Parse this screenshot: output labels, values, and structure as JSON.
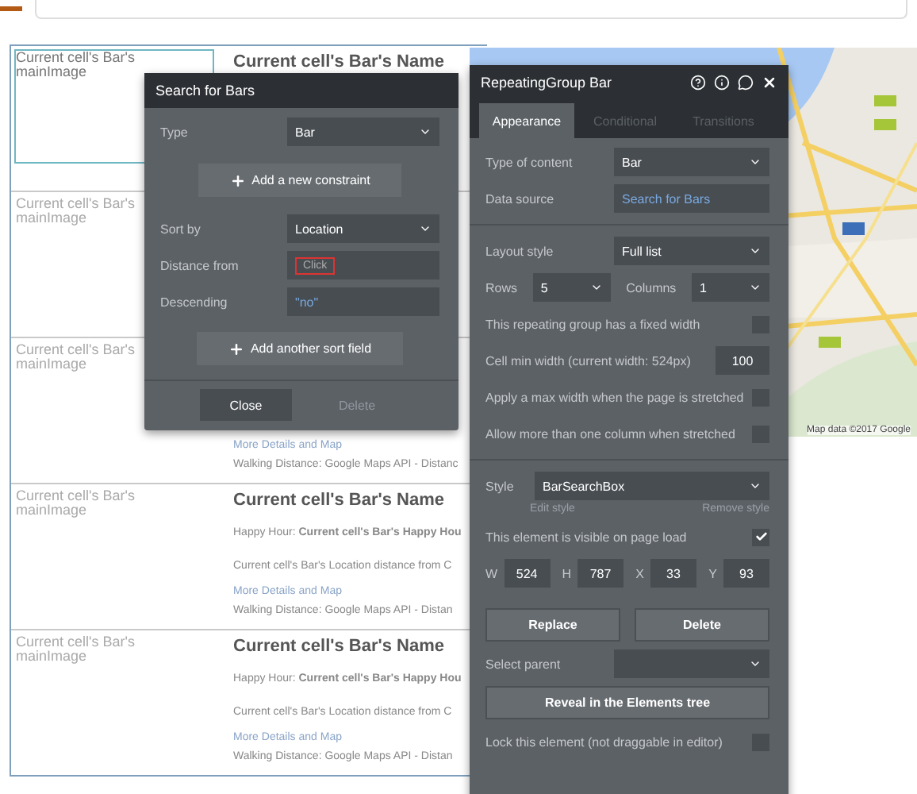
{
  "list": {
    "rows": [
      {
        "image_label": "Current cell's Bar's mainImage",
        "selected": true,
        "name": "Current cell's Bar's Name"
      },
      {
        "image_label": "Current cell's Bar's mainImage",
        "selected": false
      },
      {
        "image_label": "Current cell's Bar's mainImage",
        "selected": false,
        "link": "More Details and Map",
        "walking": "Walking Distance: Google Maps API - Distanc"
      },
      {
        "image_label": "Current cell's Bar's mainImage",
        "selected": false,
        "name": "Current cell's Bar's Name",
        "happy_hour": "Happy Hour: **Current cell's Bar's Happy Hou**",
        "distance": "Current cell's Bar's Location distance from C",
        "link": "More Details and Map",
        "walking": "Walking Distance: Google Maps API - Distan"
      },
      {
        "image_label": "Current cell's Bar's mainImage",
        "selected": false,
        "name": "Current cell's Bar's Name",
        "happy_hour": "Happy Hour: **Current cell's Bar's Happy Hou**",
        "distance": "Current cell's Bar's Location distance from C",
        "link": "More Details and Map",
        "walking": "Walking Distance: Google Maps API - Distan"
      }
    ]
  },
  "map": {
    "attribution": "Map data ©2017 Google"
  },
  "search_panel": {
    "title": "Search for Bars",
    "type": {
      "label": "Type",
      "value": "Bar"
    },
    "add_constraint": "Add a new constraint",
    "sort_by": {
      "label": "Sort by",
      "value": "Location"
    },
    "distance_from": {
      "label": "Distance from",
      "value": "Click"
    },
    "descending": {
      "label": "Descending",
      "value": "\"no\""
    },
    "add_sort": "Add another sort field",
    "buttons": [
      {
        "label": "Close",
        "disabled": false
      },
      {
        "label": "Delete",
        "disabled": true
      }
    ]
  },
  "properties_panel": {
    "title": "RepeatingGroup Bar",
    "tabs": [
      {
        "label": "Appearance",
        "selected": true
      },
      {
        "label": "Conditional",
        "selected": false
      },
      {
        "label": "Transitions",
        "selected": false
      }
    ],
    "type_of_content": {
      "label": "Type of content",
      "value": "Bar"
    },
    "data_source": {
      "label": "Data source",
      "value": "Search for Bars"
    },
    "layout_style": {
      "label": "Layout style",
      "value": "Full list"
    },
    "rows": {
      "label": "Rows",
      "value": "5"
    },
    "columns": {
      "label": "Columns",
      "value": "1"
    },
    "settings": [
      {
        "kind": "checkbox",
        "label": "This repeating group has a fixed width",
        "checked": false
      },
      {
        "kind": "number",
        "label": "Cell min width (current width: 524px)",
        "value": "100"
      },
      {
        "kind": "checkbox",
        "label": "Apply a max width when the page is stretched",
        "checked": false
      },
      {
        "kind": "checkbox",
        "label": "Allow more than one column when stretched",
        "checked": false
      }
    ],
    "style": {
      "label": "Style",
      "value": "BarSearchBox",
      "edit": "Edit style",
      "remove": "Remove style"
    },
    "visible": {
      "label": "This element is visible on page load",
      "checked": true
    },
    "geometry": [
      {
        "label": "W",
        "value": "524"
      },
      {
        "label": "H",
        "value": "787"
      },
      {
        "label": "X",
        "value": "33"
      },
      {
        "label": "Y",
        "value": "93"
      }
    ],
    "buttons": [
      "Replace",
      "Delete"
    ],
    "select_parent": {
      "label": "Select parent"
    },
    "reveal": "Reveal in the Elements tree",
    "lock": {
      "label": "Lock this element (not draggable in editor)",
      "checked": false
    }
  }
}
